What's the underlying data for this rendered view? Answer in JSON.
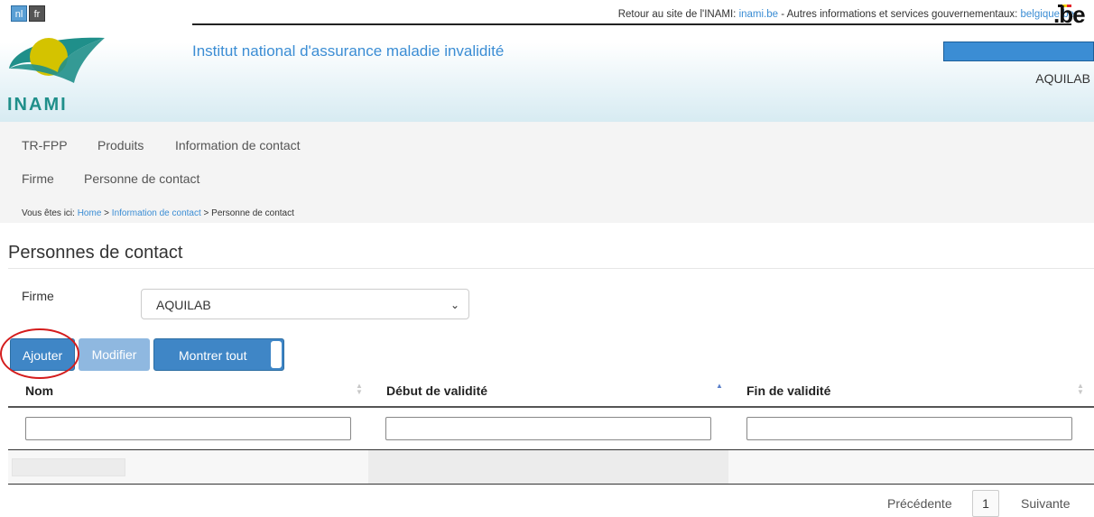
{
  "languages": {
    "nl": "nl",
    "fr": "fr"
  },
  "topbar": {
    "prefix": "Retour au site de l'INAMI: ",
    "link1": "inami.be",
    "middle": " - Autres informations et services gouvernementaux: ",
    "link2": "belgique.be",
    "be_logo": ".be"
  },
  "header": {
    "logo_text": "INAMI",
    "title": "Institut national d'assurance maladie invalidité",
    "user_name": "AQUILAB"
  },
  "nav": {
    "primary": [
      "TR-FPP",
      "Produits",
      "Information de contact"
    ],
    "secondary": [
      "Firme",
      "Personne de contact"
    ]
  },
  "breadcrumb": {
    "prefix": "Vous êtes ici: ",
    "items": [
      "Home",
      "Information de contact"
    ],
    "separator": " > ",
    "current": "Personne de contact"
  },
  "page": {
    "title": "Personnes de contact",
    "firm_label": "Firme",
    "firm_selected": "AQUILAB"
  },
  "toolbar": {
    "add_label": "Ajouter",
    "modify_label": "Modifier",
    "show_all_label": "Montrer tout"
  },
  "table": {
    "columns": [
      "Nom",
      "Début de validité",
      "Fin de validité"
    ],
    "filters": [
      "",
      "",
      ""
    ]
  },
  "pagination": {
    "prev": "Précédente",
    "current": "1",
    "next": "Suivante"
  },
  "colors": {
    "accent": "#3b8dd4",
    "button": "#3f86c6",
    "button_disabled": "#8fb8e0",
    "logo_teal": "#1f8f8a",
    "highlight": "#d41c1c"
  }
}
